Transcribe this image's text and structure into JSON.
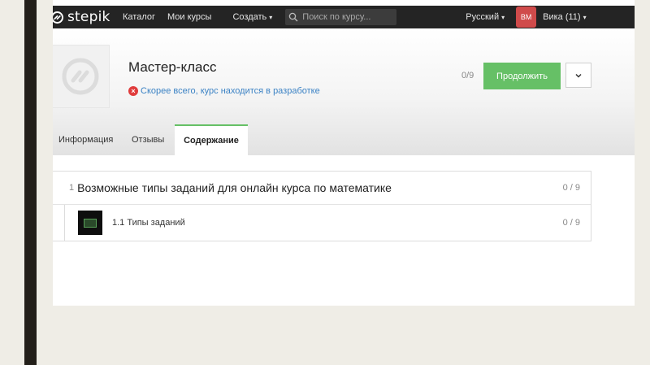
{
  "navbar": {
    "logo_text": "stepik",
    "catalog_label": "Каталог",
    "my_courses_label": "Мои курсы",
    "create_label": "Создать",
    "search_placeholder": "Поиск по курсу...",
    "language_label": "Русский",
    "avatar_initials": "ВМ",
    "user_label": "Вика (11)"
  },
  "course": {
    "title": "Мастер-класс",
    "dev_status": "Скорее всего, курс находится в разработке",
    "progress": "0/9",
    "continue_label": "Продолжить"
  },
  "tabs": [
    {
      "label": "Информация",
      "active": false
    },
    {
      "label": "Отзывы",
      "active": false
    },
    {
      "label": "Содержание",
      "active": true
    }
  ],
  "content": {
    "module": {
      "number": "1",
      "title": "Возможные типы заданий для онлайн курса по математике",
      "progress": "0 / 9",
      "lessons": [
        {
          "title": "1.1 Типы заданий",
          "progress": "0 / 9"
        }
      ]
    }
  },
  "colors": {
    "accent_green": "#66c066",
    "navbar_bg": "#242424",
    "avatar_bg": "#d04b4b",
    "link_blue": "#3b82c4",
    "error_red": "#e03c3c"
  }
}
